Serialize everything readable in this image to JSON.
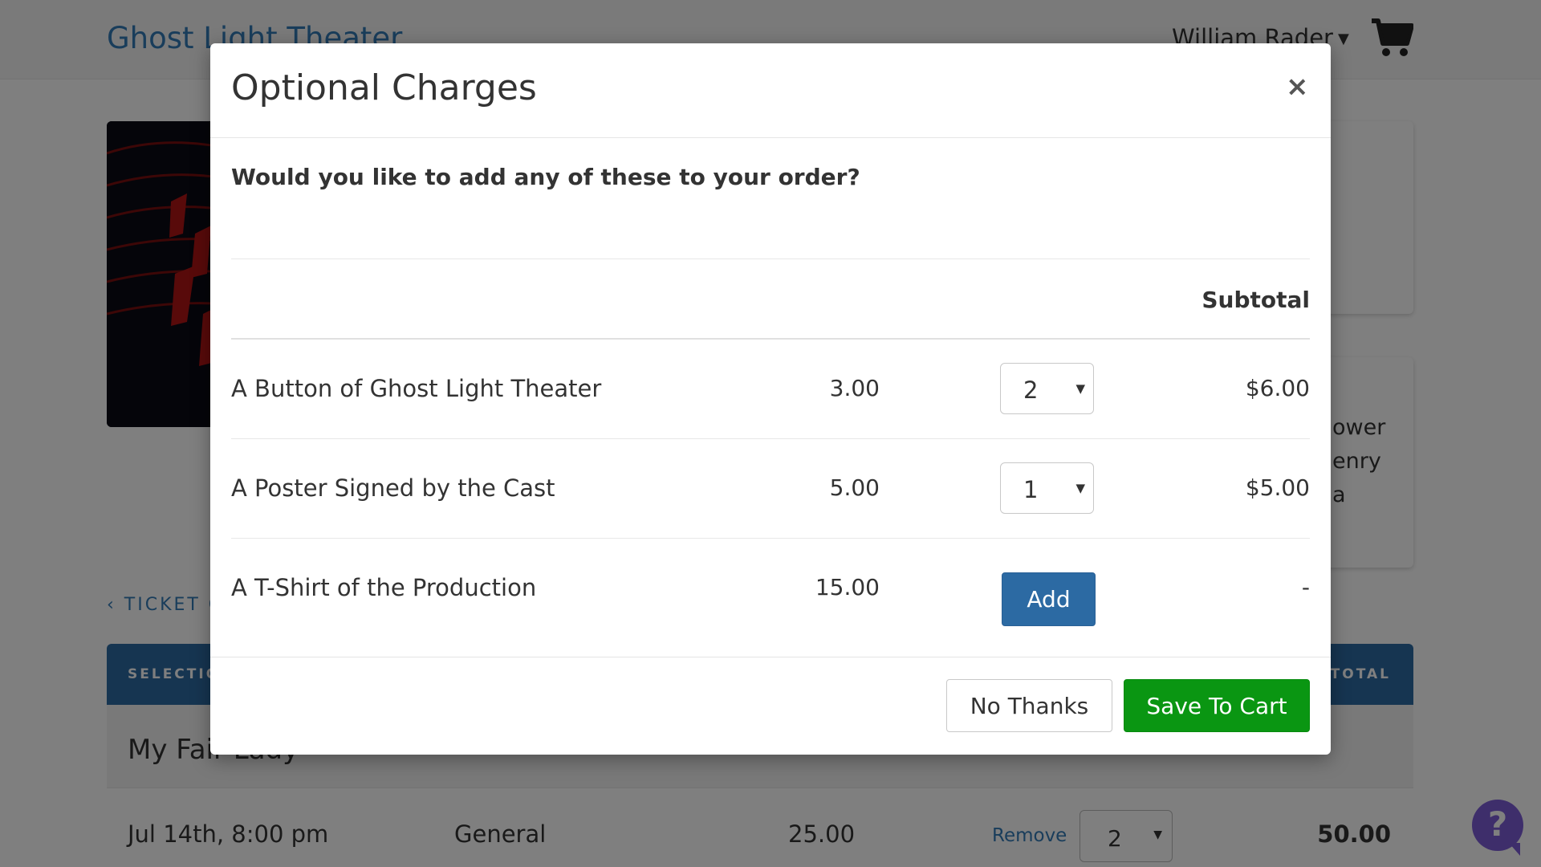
{
  "header": {
    "site_title": "Ghost Light Theater",
    "user_name": "William Rader",
    "cart_icon": "shopping-cart-icon"
  },
  "background": {
    "card_text_lines": [
      "ower",
      "enry",
      "a"
    ],
    "back_link": "‹ TICKET O",
    "cart_table": {
      "columns": [
        "SELECTIO",
        "BTOTAL"
      ],
      "event_name": "My Fair Lady",
      "line": {
        "date": "Jul 14th, 8:00 pm",
        "type": "General",
        "price": "25.00",
        "remove_label": "Remove",
        "quantity": "2",
        "subtotal": "50.00"
      }
    }
  },
  "modal": {
    "title": "Optional Charges",
    "close_label": "×",
    "question": "Would you like to add any of these to your order?",
    "subtotal_header": "Subtotal",
    "items": [
      {
        "name": "A Button of Ghost Light Theater",
        "price": "3.00",
        "quantity": "2",
        "subtotal": "$6.00"
      },
      {
        "name": "A Poster Signed by the Cast",
        "price": "5.00",
        "quantity": "1",
        "subtotal": "$5.00"
      },
      {
        "name": "A T-Shirt of the Production",
        "price": "15.00",
        "add_label": "Add",
        "subtotal": "-"
      }
    ],
    "no_thanks_label": "No Thanks",
    "save_label": "Save To Cart"
  },
  "help": {
    "label": "?"
  },
  "colors": {
    "primary": "#2c6aa3",
    "success": "#0a9612",
    "help": "#7c5cd6"
  }
}
